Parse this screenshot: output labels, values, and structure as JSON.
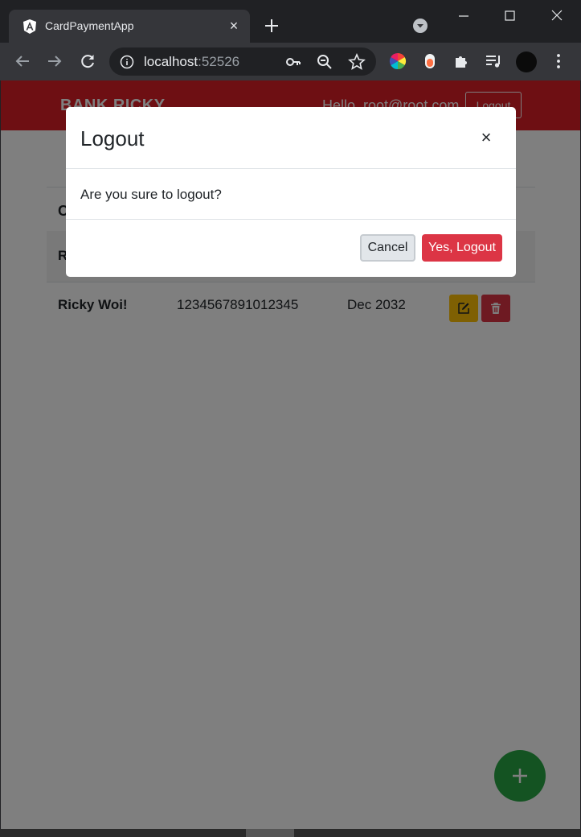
{
  "browser": {
    "tab_title": "CardPaymentApp",
    "tab_close": "×",
    "url_host": "localhost",
    "url_port": ":52526"
  },
  "page": {
    "brand": "BANK RICKY",
    "greeting": "Hello, root@root.com",
    "logout_label": "Logout",
    "card_header": "Cards",
    "table_header_first": "R",
    "rows": [
      {
        "name": "Ricky Woi!",
        "number": "1234567891012345",
        "expiry": "Dec 2032"
      }
    ]
  },
  "modal": {
    "title": "Logout",
    "close": "×",
    "message": "Are you sure to logout?",
    "cancel_label": "Cancel",
    "confirm_label": "Yes, Logout"
  },
  "colors": {
    "navbar": "#dc1f26",
    "edit_button": "#ffc107",
    "delete_button": "#dc3545",
    "fab": "#28a745",
    "confirm_button": "#dc3545"
  },
  "icons": {
    "favicon": "angular-icon",
    "edit": "edit-icon",
    "delete": "trash-icon",
    "fab": "plus-icon"
  }
}
